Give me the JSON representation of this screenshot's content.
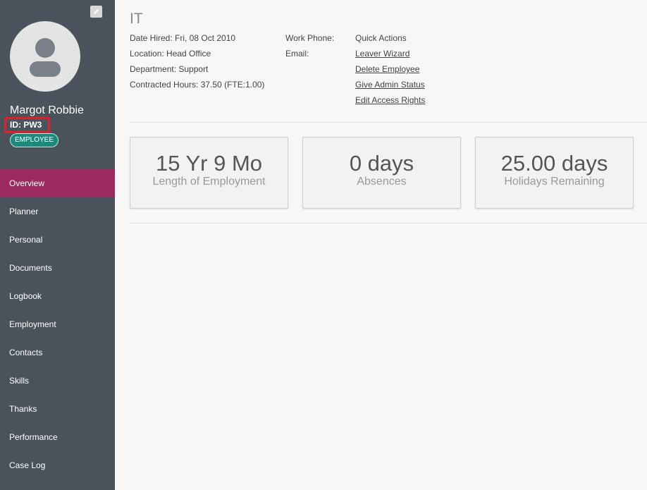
{
  "sidebar": {
    "name": "Margot Robbie",
    "id": "ID: PW3",
    "role_badge": "EMPLOYEE",
    "items": [
      {
        "label": "Overview"
      },
      {
        "label": "Planner"
      },
      {
        "label": "Personal"
      },
      {
        "label": "Documents"
      },
      {
        "label": "Logbook"
      },
      {
        "label": "Employment"
      },
      {
        "label": "Contacts"
      },
      {
        "label": "Skills"
      },
      {
        "label": "Thanks"
      },
      {
        "label": "Performance"
      },
      {
        "label": "Case Log"
      }
    ],
    "active_item": "Overview"
  },
  "main": {
    "title": "IT",
    "details": {
      "date_hired": "Date Hired: Fri, 08 Oct 2010",
      "location": "Location: Head Office",
      "department": "Department: Support",
      "contracted_hours": "Contracted Hours: 37.50 (FTE:1.00)",
      "work_phone": "Work Phone:",
      "email": "Email:"
    },
    "quick_actions": {
      "heading": "Quick Actions",
      "links": [
        "Leaver Wizard",
        "Delete Employee",
        "Give Admin Status",
        "Edit Access Rights"
      ]
    },
    "stats": [
      {
        "value": "15 Yr 9 Mo",
        "label": "Length of Employment"
      },
      {
        "value": "0 days",
        "label": "Absences"
      },
      {
        "value": "25.00 days",
        "label": "Holidays Remaining"
      }
    ]
  },
  "colors": {
    "sidebar_bg": "#4a535c",
    "active_nav": "#9b2a5f",
    "badge": "#1b8a7d",
    "highlight_box": "#e0212b"
  },
  "icons": {
    "edit": "pencil-icon",
    "avatar": "user-avatar-icon"
  }
}
